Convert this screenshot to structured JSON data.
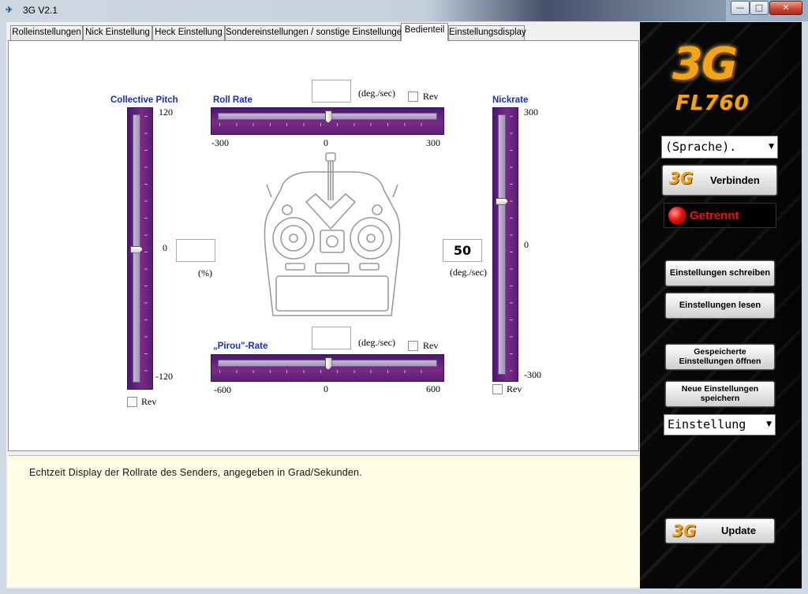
{
  "window": {
    "title": "3G V2.1",
    "minimize": "—",
    "maximize": "□",
    "close": "✕"
  },
  "tabs": [
    {
      "label": "Rolleinstellungen"
    },
    {
      "label": "Nick Einstellung"
    },
    {
      "label": "Heck Einstellung"
    },
    {
      "label": "Sondereinstellungen / sonstige Einstellungen"
    },
    {
      "label": "Bedienteil",
      "active": true
    },
    {
      "label": "Einstellungsdisplay"
    }
  ],
  "controls": {
    "collective": {
      "caption": "Collective Pitch",
      "max": "120",
      "mid": "0",
      "min": "-120",
      "value": "",
      "unit": "(%)",
      "rev_label": "Rev",
      "position": 0.5
    },
    "roll": {
      "caption": "Roll Rate",
      "min": "-300",
      "mid": "0",
      "max": "300",
      "value": "",
      "unit": "(deg./sec)",
      "rev_label": "Rev",
      "position": 0.5
    },
    "pirou": {
      "caption": "„Pirou\"-Rate",
      "min": "-600",
      "mid": "0",
      "max": "600",
      "value": "",
      "unit": "(deg./sec)",
      "rev_label": "Rev",
      "position": 0.5
    },
    "nick": {
      "caption": "Nickrate",
      "max": "300",
      "mid": "0",
      "min": "-300",
      "value": "50",
      "unit": "(deg./sec)",
      "rev_label": "Rev",
      "position": 0.33
    }
  },
  "info": {
    "text": "Echtzeit Display der Rollrate des Senders, angegeben in Grad/Sekunden."
  },
  "right_panel": {
    "logo_brand": "3G",
    "logo_model": "FL760",
    "language_combo": "(Sprache).",
    "connect_label": "Verbinden",
    "connect_logo": "3G",
    "status": "Getrennt",
    "write_label": "Einstellungen schreiben",
    "read_label": "Einstellungen lesen",
    "open_label_1": "Gespeicherte",
    "open_label_2": "Einstellungen öffnen",
    "save_label_1": "Neue Einstellungen",
    "save_label_2": "speichern",
    "setting_combo": "Einstellung",
    "update_label": "Update",
    "update_logo": "3G",
    "colors": {
      "accent": "#f3a41b",
      "status": "#e11111",
      "slider": "#6a2380"
    }
  }
}
